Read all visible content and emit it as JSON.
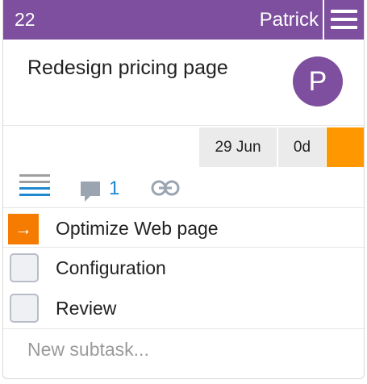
{
  "card": {
    "id": "22",
    "assignee": "Patrick",
    "title": "Redesign pricing page",
    "avatar_initial": "P",
    "date": "29 Jun",
    "duration": "0d",
    "comment_count": "1",
    "subtasks": [
      {
        "label": "Optimize Web page",
        "state": "current"
      },
      {
        "label": "Configuration",
        "state": "unchecked"
      },
      {
        "label": "Review",
        "state": "unchecked"
      }
    ],
    "new_subtask_placeholder": "New subtask..."
  },
  "colors": {
    "header": "#7d4f9e",
    "accent_orange": "#ff9800",
    "link_blue": "#1e88d1"
  },
  "icons": [
    "hamburger-menu-icon",
    "description-lines-icon",
    "comment-icon",
    "link-icon",
    "arrow-right-icon"
  ]
}
